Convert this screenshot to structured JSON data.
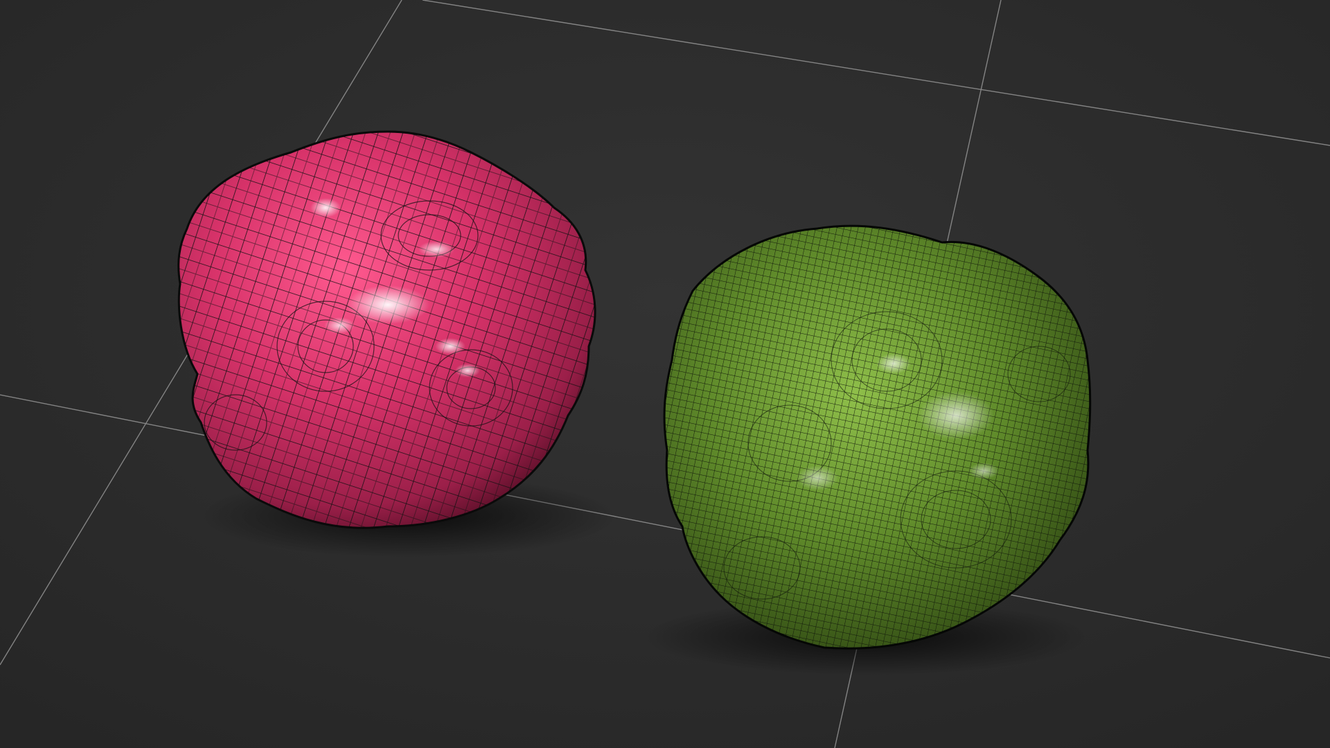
{
  "viewport": {
    "background_color": "#2e2e2e",
    "grid_line_color": "#9a9a9a",
    "shading_mode": "edged-faces"
  },
  "objects": [
    {
      "name": "pink-blob",
      "mesh_density": "low",
      "surface_color": "#d8336a",
      "wire_color": "#111111"
    },
    {
      "name": "green-blob",
      "mesh_density": "high",
      "surface_color": "#5f8a2a",
      "wire_color": "#0f140a"
    }
  ]
}
